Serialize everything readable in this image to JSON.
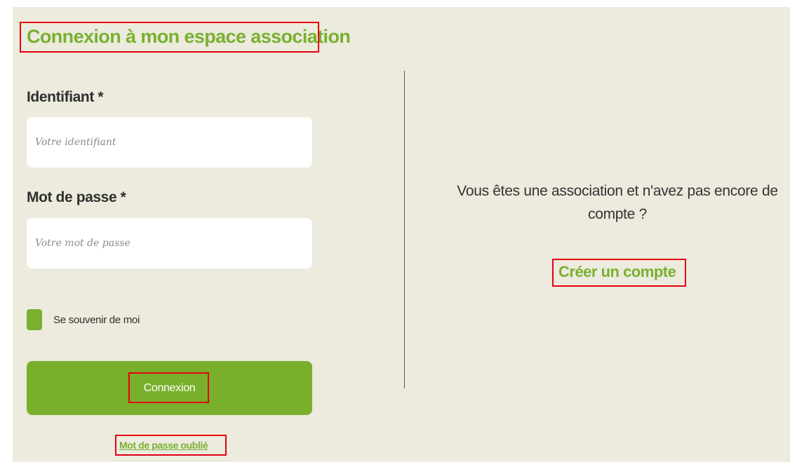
{
  "page": {
    "title": "Connexion à mon espace association"
  },
  "form": {
    "identifier_label": "Identifiant *",
    "identifier_placeholder": "Votre identifiant",
    "password_label": "Mot de passe *",
    "password_placeholder": "Votre mot de passe",
    "remember_label": "Se souvenir de moi",
    "submit_label": "Connexion",
    "forgot_label": "Mot de passe oublié"
  },
  "signup": {
    "prompt": "Vous êtes une association et n'avez pas encore de compte ?",
    "link_label": "Créer un compte"
  },
  "colors": {
    "brand_green": "#7ab030",
    "panel_background": "#ecebde",
    "annotation_red": "#e3000f"
  }
}
